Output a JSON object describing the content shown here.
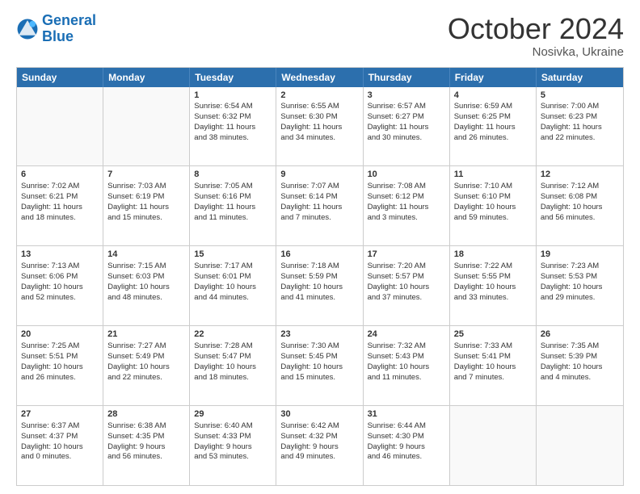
{
  "header": {
    "logo_general": "General",
    "logo_blue": "Blue",
    "month_title": "October 2024",
    "subtitle": "Nosivka, Ukraine"
  },
  "weekdays": [
    "Sunday",
    "Monday",
    "Tuesday",
    "Wednesday",
    "Thursday",
    "Friday",
    "Saturday"
  ],
  "rows": [
    [
      {
        "day": "",
        "lines": [],
        "empty": true
      },
      {
        "day": "",
        "lines": [],
        "empty": true
      },
      {
        "day": "1",
        "lines": [
          "Sunrise: 6:54 AM",
          "Sunset: 6:32 PM",
          "Daylight: 11 hours",
          "and 38 minutes."
        ]
      },
      {
        "day": "2",
        "lines": [
          "Sunrise: 6:55 AM",
          "Sunset: 6:30 PM",
          "Daylight: 11 hours",
          "and 34 minutes."
        ]
      },
      {
        "day": "3",
        "lines": [
          "Sunrise: 6:57 AM",
          "Sunset: 6:27 PM",
          "Daylight: 11 hours",
          "and 30 minutes."
        ]
      },
      {
        "day": "4",
        "lines": [
          "Sunrise: 6:59 AM",
          "Sunset: 6:25 PM",
          "Daylight: 11 hours",
          "and 26 minutes."
        ]
      },
      {
        "day": "5",
        "lines": [
          "Sunrise: 7:00 AM",
          "Sunset: 6:23 PM",
          "Daylight: 11 hours",
          "and 22 minutes."
        ]
      }
    ],
    [
      {
        "day": "6",
        "lines": [
          "Sunrise: 7:02 AM",
          "Sunset: 6:21 PM",
          "Daylight: 11 hours",
          "and 18 minutes."
        ]
      },
      {
        "day": "7",
        "lines": [
          "Sunrise: 7:03 AM",
          "Sunset: 6:19 PM",
          "Daylight: 11 hours",
          "and 15 minutes."
        ]
      },
      {
        "day": "8",
        "lines": [
          "Sunrise: 7:05 AM",
          "Sunset: 6:16 PM",
          "Daylight: 11 hours",
          "and 11 minutes."
        ]
      },
      {
        "day": "9",
        "lines": [
          "Sunrise: 7:07 AM",
          "Sunset: 6:14 PM",
          "Daylight: 11 hours",
          "and 7 minutes."
        ]
      },
      {
        "day": "10",
        "lines": [
          "Sunrise: 7:08 AM",
          "Sunset: 6:12 PM",
          "Daylight: 11 hours",
          "and 3 minutes."
        ]
      },
      {
        "day": "11",
        "lines": [
          "Sunrise: 7:10 AM",
          "Sunset: 6:10 PM",
          "Daylight: 10 hours",
          "and 59 minutes."
        ]
      },
      {
        "day": "12",
        "lines": [
          "Sunrise: 7:12 AM",
          "Sunset: 6:08 PM",
          "Daylight: 10 hours",
          "and 56 minutes."
        ]
      }
    ],
    [
      {
        "day": "13",
        "lines": [
          "Sunrise: 7:13 AM",
          "Sunset: 6:06 PM",
          "Daylight: 10 hours",
          "and 52 minutes."
        ]
      },
      {
        "day": "14",
        "lines": [
          "Sunrise: 7:15 AM",
          "Sunset: 6:03 PM",
          "Daylight: 10 hours",
          "and 48 minutes."
        ]
      },
      {
        "day": "15",
        "lines": [
          "Sunrise: 7:17 AM",
          "Sunset: 6:01 PM",
          "Daylight: 10 hours",
          "and 44 minutes."
        ]
      },
      {
        "day": "16",
        "lines": [
          "Sunrise: 7:18 AM",
          "Sunset: 5:59 PM",
          "Daylight: 10 hours",
          "and 41 minutes."
        ]
      },
      {
        "day": "17",
        "lines": [
          "Sunrise: 7:20 AM",
          "Sunset: 5:57 PM",
          "Daylight: 10 hours",
          "and 37 minutes."
        ]
      },
      {
        "day": "18",
        "lines": [
          "Sunrise: 7:22 AM",
          "Sunset: 5:55 PM",
          "Daylight: 10 hours",
          "and 33 minutes."
        ]
      },
      {
        "day": "19",
        "lines": [
          "Sunrise: 7:23 AM",
          "Sunset: 5:53 PM",
          "Daylight: 10 hours",
          "and 29 minutes."
        ]
      }
    ],
    [
      {
        "day": "20",
        "lines": [
          "Sunrise: 7:25 AM",
          "Sunset: 5:51 PM",
          "Daylight: 10 hours",
          "and 26 minutes."
        ]
      },
      {
        "day": "21",
        "lines": [
          "Sunrise: 7:27 AM",
          "Sunset: 5:49 PM",
          "Daylight: 10 hours",
          "and 22 minutes."
        ]
      },
      {
        "day": "22",
        "lines": [
          "Sunrise: 7:28 AM",
          "Sunset: 5:47 PM",
          "Daylight: 10 hours",
          "and 18 minutes."
        ]
      },
      {
        "day": "23",
        "lines": [
          "Sunrise: 7:30 AM",
          "Sunset: 5:45 PM",
          "Daylight: 10 hours",
          "and 15 minutes."
        ]
      },
      {
        "day": "24",
        "lines": [
          "Sunrise: 7:32 AM",
          "Sunset: 5:43 PM",
          "Daylight: 10 hours",
          "and 11 minutes."
        ]
      },
      {
        "day": "25",
        "lines": [
          "Sunrise: 7:33 AM",
          "Sunset: 5:41 PM",
          "Daylight: 10 hours",
          "and 7 minutes."
        ]
      },
      {
        "day": "26",
        "lines": [
          "Sunrise: 7:35 AM",
          "Sunset: 5:39 PM",
          "Daylight: 10 hours",
          "and 4 minutes."
        ]
      }
    ],
    [
      {
        "day": "27",
        "lines": [
          "Sunrise: 6:37 AM",
          "Sunset: 4:37 PM",
          "Daylight: 10 hours",
          "and 0 minutes."
        ]
      },
      {
        "day": "28",
        "lines": [
          "Sunrise: 6:38 AM",
          "Sunset: 4:35 PM",
          "Daylight: 9 hours",
          "and 56 minutes."
        ]
      },
      {
        "day": "29",
        "lines": [
          "Sunrise: 6:40 AM",
          "Sunset: 4:33 PM",
          "Daylight: 9 hours",
          "and 53 minutes."
        ]
      },
      {
        "day": "30",
        "lines": [
          "Sunrise: 6:42 AM",
          "Sunset: 4:32 PM",
          "Daylight: 9 hours",
          "and 49 minutes."
        ]
      },
      {
        "day": "31",
        "lines": [
          "Sunrise: 6:44 AM",
          "Sunset: 4:30 PM",
          "Daylight: 9 hours",
          "and 46 minutes."
        ]
      },
      {
        "day": "",
        "lines": [],
        "empty": true
      },
      {
        "day": "",
        "lines": [],
        "empty": true
      }
    ]
  ]
}
